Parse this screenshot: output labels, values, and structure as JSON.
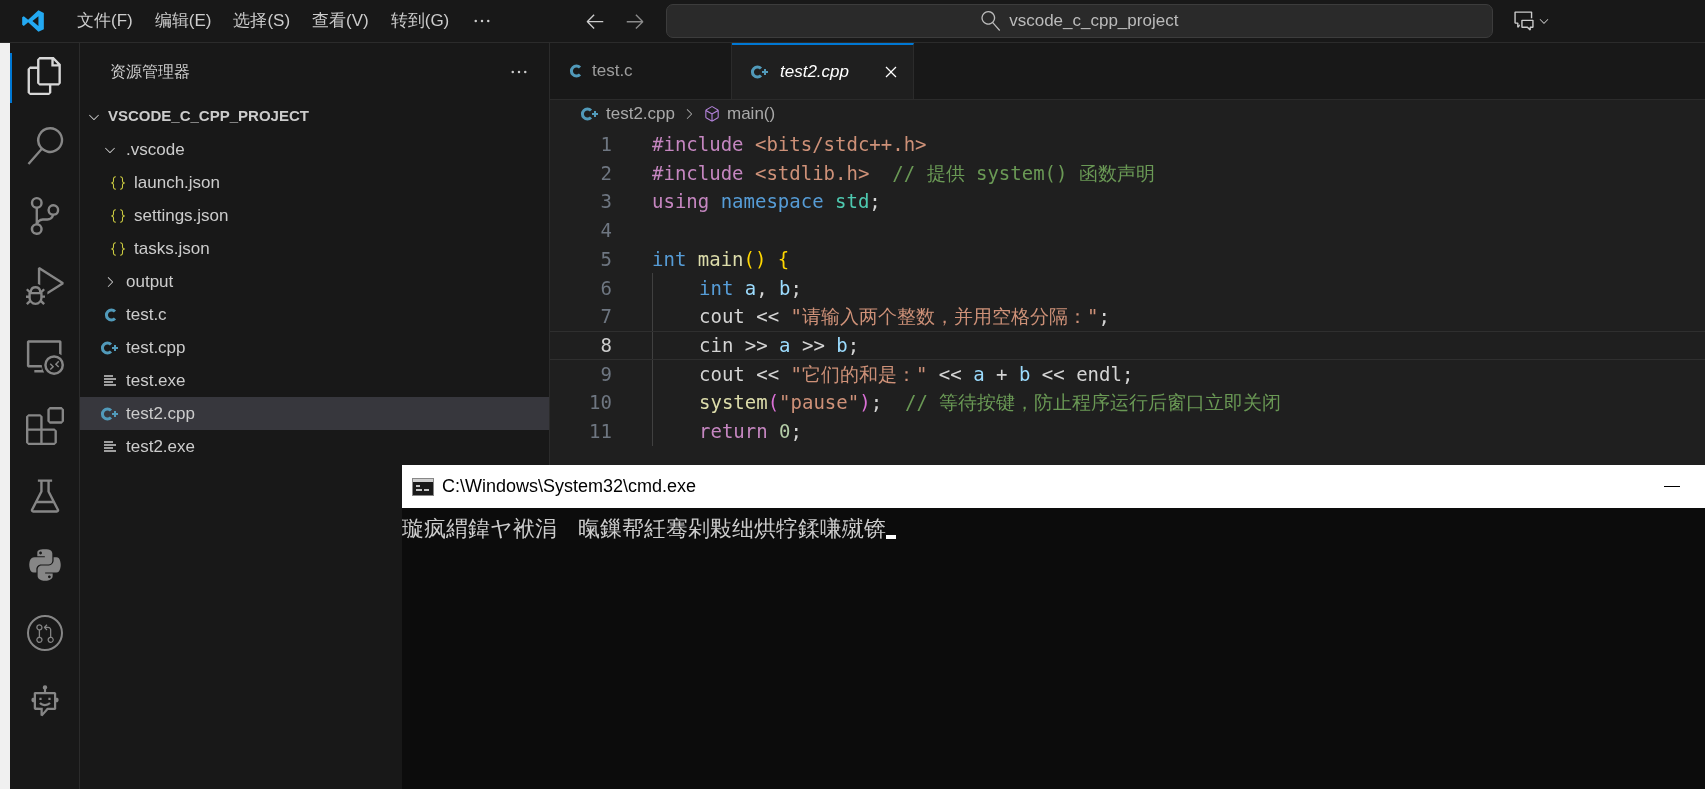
{
  "menu": [
    "文件(F)",
    "编辑(E)",
    "选择(S)",
    "查看(V)",
    "转到(G)"
  ],
  "command_center": {
    "value": "vscode_c_cpp_project"
  },
  "explorer": {
    "title": "资源管理器",
    "root": {
      "label": "VSCODE_C_CPP_PROJECT",
      "expanded": true,
      "children": [
        {
          "label": ".vscode",
          "kind": "folder",
          "expanded": true,
          "children": [
            {
              "label": "launch.json",
              "kind": "json",
              "selected": false
            },
            {
              "label": "settings.json",
              "kind": "json",
              "selected": false
            },
            {
              "label": "tasks.json",
              "kind": "json",
              "selected": false
            }
          ]
        },
        {
          "label": "output",
          "kind": "folder",
          "expanded": false
        },
        {
          "label": "test.c",
          "kind": "c",
          "selected": false
        },
        {
          "label": "test.cpp",
          "kind": "cpp",
          "selected": false
        },
        {
          "label": "test.exe",
          "kind": "exe",
          "selected": false
        },
        {
          "label": "test2.cpp",
          "kind": "cpp",
          "selected": true
        },
        {
          "label": "test2.exe",
          "kind": "exe",
          "selected": false
        }
      ]
    }
  },
  "tabs": [
    {
      "label": "test.c",
      "kind": "c",
      "selected": false
    },
    {
      "label": "test2.cpp",
      "kind": "cpp",
      "selected": true
    }
  ],
  "breadcrumb": [
    {
      "label": "test2.cpp",
      "kind": "cpp"
    },
    {
      "label": "main()",
      "kind": "symbol"
    }
  ],
  "code": [
    {
      "number": "1",
      "current": false,
      "indented": false,
      "tokens": [
        {
          "t": "#include ",
          "kind": "directive"
        },
        {
          "t": "<bits/stdc++.h>",
          "kind": "string"
        }
      ]
    },
    {
      "number": "2",
      "current": false,
      "indented": false,
      "tokens": [
        {
          "t": "#include ",
          "kind": "directive"
        },
        {
          "t": "<stdlib.h>",
          "kind": "string"
        },
        {
          "t": "  // 提供 system() 函数声明",
          "kind": "comment"
        }
      ]
    },
    {
      "number": "3",
      "current": false,
      "indented": false,
      "tokens": [
        {
          "t": "using ",
          "kind": "directive"
        },
        {
          "t": "namespace ",
          "kind": "keyword"
        },
        {
          "t": "std",
          "kind": "type"
        },
        {
          "t": ";",
          "kind": "plain"
        }
      ]
    },
    {
      "number": "4",
      "current": false,
      "indented": false
    },
    {
      "number": "5",
      "current": false,
      "indented": false,
      "tokens": [
        {
          "t": "int ",
          "kind": "keyword"
        },
        {
          "t": "main",
          "kind": "func"
        },
        {
          "t": "() {",
          "kind": "bracket"
        }
      ]
    },
    {
      "number": "6",
      "current": false,
      "indented": true,
      "tokens": [
        {
          "t": "int ",
          "kind": "keyword"
        },
        {
          "t": "a",
          "kind": "var"
        },
        {
          "t": ", ",
          "kind": "plain"
        },
        {
          "t": "b",
          "kind": "var"
        },
        {
          "t": ";",
          "kind": "plain"
        }
      ]
    },
    {
      "number": "7",
      "current": false,
      "indented": true,
      "tokens": [
        {
          "t": "cout << ",
          "kind": "plain"
        },
        {
          "t": "\"请输入两个整数，并用空格分隔：\"",
          "kind": "string"
        },
        {
          "t": ";",
          "kind": "plain"
        }
      ]
    },
    {
      "number": "8",
      "current": true,
      "indented": true,
      "tokens": [
        {
          "t": "cin >> ",
          "kind": "plain"
        },
        {
          "t": "a",
          "kind": "var"
        },
        {
          "t": " >> ",
          "kind": "plain"
        },
        {
          "t": "b",
          "kind": "var"
        },
        {
          "t": ";",
          "kind": "plain"
        }
      ]
    },
    {
      "number": "9",
      "current": false,
      "indented": true,
      "tokens": [
        {
          "t": "cout << ",
          "kind": "plain"
        },
        {
          "t": "\"它们的和是：\"",
          "kind": "string"
        },
        {
          "t": " << ",
          "kind": "plain"
        },
        {
          "t": "a",
          "kind": "var"
        },
        {
          "t": " + ",
          "kind": "plain"
        },
        {
          "t": "b",
          "kind": "var"
        },
        {
          "t": " << endl;",
          "kind": "plain"
        }
      ]
    },
    {
      "number": "10",
      "current": false,
      "indented": true,
      "tokens": [
        {
          "t": "system",
          "kind": "func"
        },
        {
          "t": "(",
          "kind": "bracket2"
        },
        {
          "t": "\"pause\"",
          "kind": "string"
        },
        {
          "t": ")",
          "kind": "bracket2"
        },
        {
          "t": ";",
          "kind": "plain"
        },
        {
          "t": "  // 等待按键，防止程序运行后窗口立即关闭",
          "kind": "comment"
        }
      ]
    },
    {
      "number": "11",
      "current": false,
      "indented": true,
      "tokens": [
        {
          "t": "return ",
          "kind": "directive"
        },
        {
          "t": "0",
          "kind": "number"
        },
        {
          "t": ";",
          "kind": "plain"
        }
      ]
    }
  ],
  "console": {
    "title": "C:\\Windows\\System32\\cmd.exe",
    "output": "璇疯緭鍏ヤ袱涓   暣鏁帮紝骞剁敤绌烘牸鍒嗛殧锛"
  }
}
